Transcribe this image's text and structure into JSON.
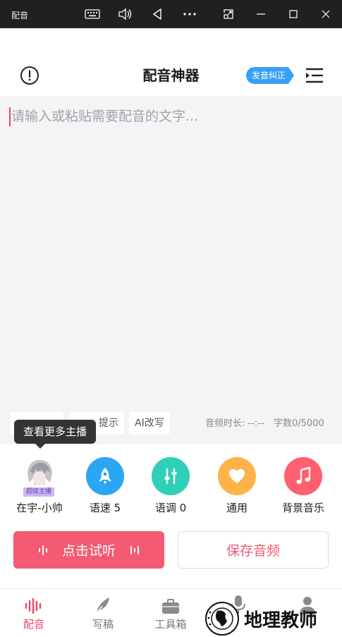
{
  "titlebar": {
    "app_title": "配音",
    "icons": [
      "keyboard-icon",
      "volume-icon",
      "back-icon",
      "more-icon",
      "screen-share-icon",
      "minimize-icon",
      "maximize-icon",
      "close-icon"
    ]
  },
  "header": {
    "title": "配音神器",
    "pronunciation_badge": "发音纠正",
    "icons": [
      "info-icon",
      "menu-icon"
    ]
  },
  "editor": {
    "placeholder": "请输入或粘贴需要配音的文字..."
  },
  "editor_tools": {
    "chips": [
      "",
      "提示",
      "AI改写"
    ],
    "duration_label": "音频时长: --:--",
    "char_count_label": "字数0/5000"
  },
  "tooltip": {
    "text": "查看更多主播"
  },
  "tools": [
    {
      "label": "在宇-小帅",
      "badge": "超级主播",
      "icon": "avatar"
    },
    {
      "label": "语速 5",
      "icon": "rocket-icon",
      "color": "#2aa6f3"
    },
    {
      "label": "语调 0",
      "icon": "sliders-icon",
      "color": "#2fcfb8"
    },
    {
      "label": "通用",
      "icon": "heart-icon",
      "color": "#ffb24a"
    },
    {
      "label": "背景音乐",
      "icon": "music-note-icon",
      "color": "#ff5f6e"
    }
  ],
  "actions": {
    "listen_label": "点击试听",
    "save_label": "保存音频"
  },
  "bottom_nav": [
    {
      "label": "配音",
      "icon": "waveform-icon",
      "active": true
    },
    {
      "label": "写稿",
      "icon": "feather-icon",
      "active": false
    },
    {
      "label": "工具箱",
      "icon": "toolbox-icon",
      "active": false
    },
    {
      "label": "",
      "icon": "microphone-icon",
      "active": false
    },
    {
      "label": "",
      "icon": "person-icon",
      "active": false
    }
  ],
  "watermark": {
    "text": "地理教师"
  },
  "colors": {
    "accent": "#f45a72",
    "badge_blue": "#3aa0f5",
    "editor_bg": "#f4f4f6",
    "titlebar_bg": "#202020"
  }
}
